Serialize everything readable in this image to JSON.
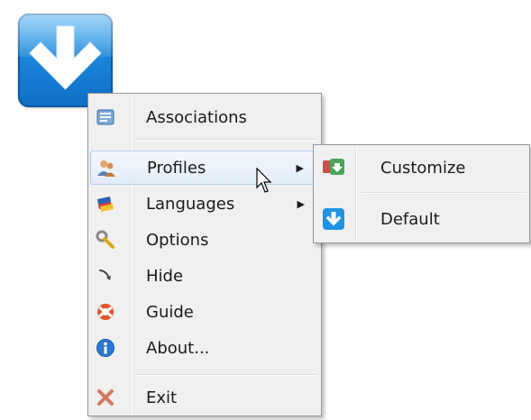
{
  "menu": {
    "items": [
      {
        "label": "Associations",
        "icon": "associations-icon"
      },
      {
        "label": "Profiles",
        "icon": "profiles-icon",
        "has_submenu": true
      },
      {
        "label": "Languages",
        "icon": "languages-icon",
        "has_submenu": true
      },
      {
        "label": "Options",
        "icon": "options-icon"
      },
      {
        "label": "Hide",
        "icon": "hide-icon"
      },
      {
        "label": "Guide",
        "icon": "guide-icon"
      },
      {
        "label": "About...",
        "icon": "about-icon"
      },
      {
        "label": "Exit",
        "icon": "exit-icon"
      }
    ],
    "submenu_arrow": "▶"
  },
  "submenu": {
    "items": [
      {
        "label": "Customize",
        "icon": "customize-icon"
      },
      {
        "label": "Default",
        "icon": "default-icon"
      }
    ]
  },
  "colors": {
    "accent_blue": "#1a86db",
    "highlight": "#e2ecf8",
    "menu_bg": "#f0f0f0"
  }
}
